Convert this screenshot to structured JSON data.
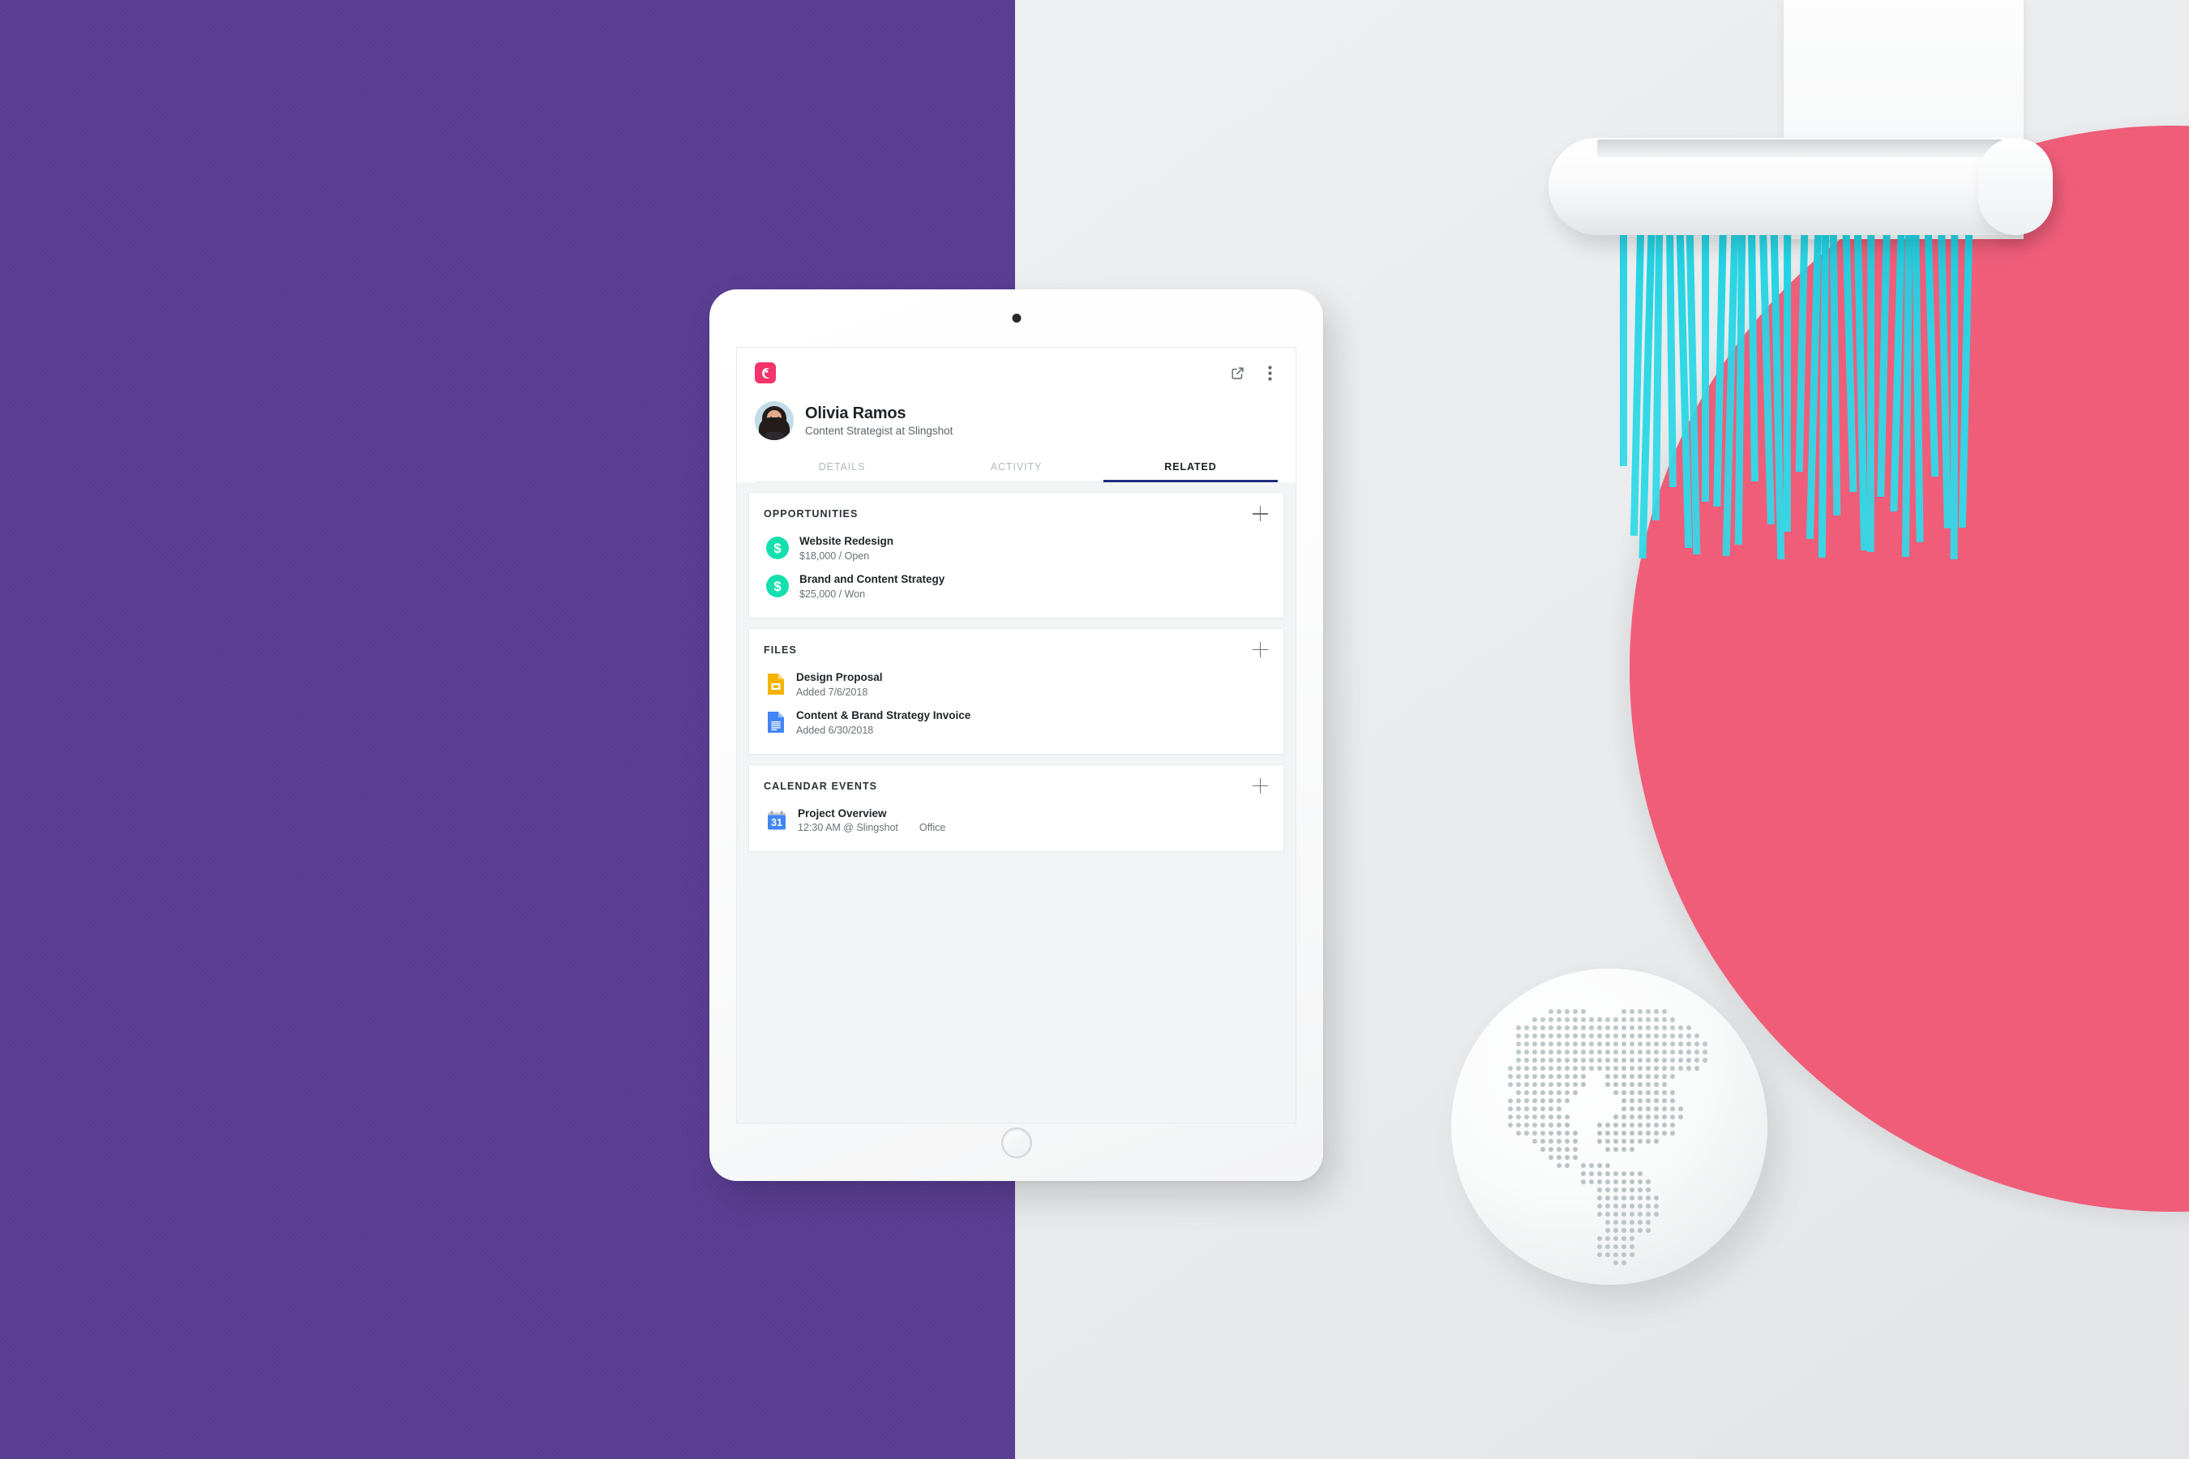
{
  "scene": {
    "background_purple": "#5a3d93",
    "background_light": "#eceff1",
    "pink_circle_color": "#ef5d79",
    "shred_strip_color": "#2ad7e6",
    "objects": {
      "shredder_label": "paper-shredder",
      "paper_label": "white-paper-sheet",
      "globe_label": "dotted-globe-ball"
    }
  },
  "device": {
    "label": "white-tablet",
    "camera_label": "front-camera",
    "home_button_label": "home-button"
  },
  "app": {
    "logo_name": "copper-crm-logo",
    "logo_color": "#f2356a",
    "actions": [
      {
        "name": "open-in-new-icon",
        "label": "Open in new window"
      },
      {
        "name": "more-options-icon",
        "label": "More options"
      }
    ],
    "person": {
      "name": "Olivia Ramos",
      "subtitle": "Content Strategist at Slingshot",
      "avatar_bg": "#c2dbe8"
    },
    "tabs": [
      {
        "label": "DETAILS",
        "active": false
      },
      {
        "label": "ACTIVITY",
        "active": false
      },
      {
        "label": "RELATED",
        "active": true
      }
    ],
    "active_tab_underline_color": "#1f2e80",
    "sections": [
      {
        "title": "OPPORTUNITIES",
        "add_label": "+",
        "icon_type": "money",
        "icon_color": "#15e0ad",
        "items": [
          {
            "title": "Website Redesign",
            "sub": "$18,000 / Open",
            "amount": "$18,000",
            "status": "Open"
          },
          {
            "title": "Brand and Content Strategy",
            "sub": "$25,000 / Won",
            "amount": "$25,000",
            "status": "Won"
          }
        ]
      },
      {
        "title": "FILES",
        "add_label": "+",
        "icon_type": "document",
        "items": [
          {
            "title": "Design Proposal",
            "sub": "Added 7/6/2018",
            "file_icon": "google-slides-icon",
            "icon_color": "#f4b400"
          },
          {
            "title": "Content & Brand Strategy Invoice",
            "sub": "Added 6/30/2018",
            "file_icon": "google-docs-icon",
            "icon_color": "#4285f4"
          }
        ]
      },
      {
        "title": "CALENDAR EVENTS",
        "add_label": "+",
        "icon_type": "calendar",
        "items": [
          {
            "title": "Project Overview",
            "sub": "12:30 AM @ Slingshot",
            "sub2": "Office",
            "calendar_day": "31",
            "icon_color": "#4285f4"
          }
        ]
      }
    ]
  }
}
